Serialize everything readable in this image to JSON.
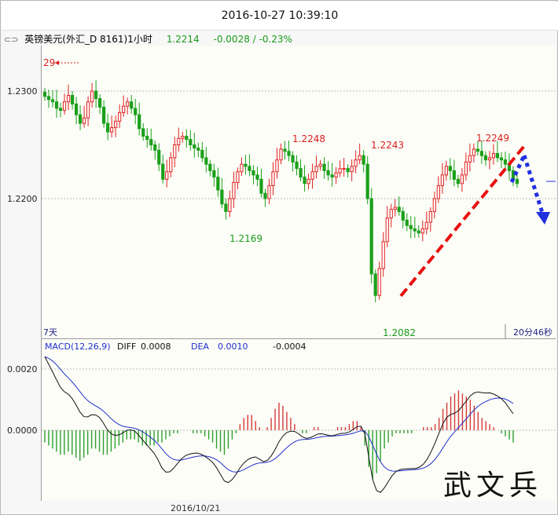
{
  "header": {
    "datetime": "2016-10-27 10:39:10",
    "symbol": "英镑美元(外汇_D 8161)1小时",
    "price": "1.2214",
    "change": "-0.0028 / -0.23%"
  },
  "main_chart": {
    "y_ticks": [
      "1.2300",
      "1.2200"
    ],
    "left_label": "7天",
    "right_label": "20分46秒",
    "marker_29": "29",
    "annotations": [
      {
        "text": "1.2248",
        "color": "red"
      },
      {
        "text": "1.2243",
        "color": "red"
      },
      {
        "text": "1.2249",
        "color": "red"
      },
      {
        "text": "1.2169",
        "color": "green"
      },
      {
        "text": "1.2082",
        "color": "green"
      }
    ]
  },
  "macd": {
    "title": "MACD(12,26,9)",
    "diff_label": "DIFF",
    "diff_value": "0.0008",
    "dea_label": "DEA",
    "dea_value": "0.0010",
    "hist_value": "-0.0004",
    "y_ticks": [
      "0.0020",
      "0.0000"
    ]
  },
  "bottom_date": "2016/10/21",
  "watermark": "武文兵",
  "colors": {
    "up": "#e02020",
    "down": "#1aa01a",
    "diff": "#111111",
    "dea": "#1f2fcc"
  },
  "chart_data": {
    "type": "candlestick",
    "title": "英镑美元(外汇_D 8161)1小时",
    "ylim": [
      1.2055,
      1.2328
    ],
    "y_ticks": [
      1.23,
      1.22
    ],
    "labeled_points": [
      {
        "label": "1.2248",
        "value": 1.2248,
        "kind": "high"
      },
      {
        "label": "1.2243",
        "value": 1.2243,
        "kind": "high"
      },
      {
        "label": "1.2249",
        "value": 1.2249,
        "kind": "high"
      },
      {
        "label": "1.2169",
        "value": 1.2169,
        "kind": "low"
      },
      {
        "label": "1.2082",
        "value": 1.2082,
        "kind": "low"
      }
    ],
    "last_price": 1.2214,
    "closes": [
      1.2295,
      1.2292,
      1.229,
      1.2284,
      1.2282,
      1.229,
      1.2296,
      1.2288,
      1.2278,
      1.227,
      1.2275,
      1.229,
      1.23,
      1.2293,
      1.2285,
      1.227,
      1.2262,
      1.2266,
      1.2272,
      1.228,
      1.2286,
      1.229,
      1.2284,
      1.2278,
      1.2265,
      1.2258,
      1.2255,
      1.225,
      1.2245,
      1.2232,
      1.2218,
      1.2225,
      1.2238,
      1.225,
      1.2256,
      1.2258,
      1.2255,
      1.225,
      1.2247,
      1.2245,
      1.2238,
      1.2232,
      1.2226,
      1.222,
      1.2208,
      1.2195,
      1.2188,
      1.22,
      1.2215,
      1.2225,
      1.2232,
      1.223,
      1.2226,
      1.2222,
      1.2218,
      1.2205,
      1.22,
      1.2212,
      1.2225,
      1.2236,
      1.2246,
      1.2244,
      1.224,
      1.2234,
      1.2228,
      1.222,
      1.2214,
      1.2218,
      1.2225,
      1.223,
      1.2232,
      1.2226,
      1.2222,
      1.222,
      1.2224,
      1.2228,
      1.2228,
      1.2225,
      1.223,
      1.2236,
      1.224,
      1.2232,
      1.22,
      1.213,
      1.211,
      1.2135,
      1.216,
      1.2182,
      1.219,
      1.2192,
      1.2188,
      1.218,
      1.2175,
      1.2172,
      1.217,
      1.2168,
      1.2172,
      1.2178,
      1.2188,
      1.22,
      1.2212,
      1.2222,
      1.223,
      1.2226,
      1.2218,
      1.2214,
      1.2222,
      1.2234,
      1.224,
      1.2246,
      1.2244,
      1.224,
      1.2236,
      1.2238,
      1.2242,
      1.2238,
      1.2236,
      1.2232,
      1.2226,
      1.2218,
      1.2214
    ],
    "macd_hist": [
      -0.0004,
      -0.0005,
      -0.0006,
      -0.0007,
      -0.0008,
      -0.0008,
      -0.0007,
      -0.0008,
      -0.0009,
      -0.001,
      -0.0009,
      -0.0008,
      -0.0006,
      -0.0006,
      -0.0007,
      -0.0008,
      -0.0008,
      -0.0007,
      -0.0006,
      -0.0005,
      -0.0004,
      -0.0003,
      -0.0003,
      -0.0003,
      -0.0004,
      -0.0005,
      -0.0005,
      -0.0005,
      -0.0005,
      -0.0004,
      -0.0004,
      -0.0003,
      -0.0002,
      -0.0001,
      -0.0001,
      0.0,
      0.0,
      0.0,
      -0.0001,
      -0.0001,
      -0.0001,
      -0.0002,
      -0.0003,
      -0.0004,
      -0.0006,
      -0.0007,
      -0.0008,
      -0.0006,
      -0.0003,
      -0.0001,
      0.0002,
      0.0004,
      0.0005,
      0.0005,
      0.0003,
      0.0001,
      0.0,
      0.0001,
      0.0004,
      0.0007,
      0.0009,
      0.0008,
      0.0006,
      0.0004,
      0.0002,
      0.0,
      -0.0001,
      -0.0001,
      0.0,
      0.0001,
      0.0001,
      0.0,
      0.0,
      0.0,
      0.0,
      0.0001,
      0.0001,
      0.0001,
      0.0002,
      0.0003,
      0.0003,
      0.0001,
      -0.0005,
      -0.0012,
      -0.0016,
      -0.0014,
      -0.001,
      -0.0006,
      -0.0004,
      -0.0002,
      -0.0001,
      -0.0001,
      -0.0001,
      -0.0001,
      -0.0001,
      0.0,
      0.0,
      0.0001,
      0.0001,
      0.0001,
      0.0002,
      0.0004,
      0.0007,
      0.0009,
      0.0011,
      0.0012,
      0.0013,
      0.0012,
      0.0011,
      0.001,
      0.0008,
      0.0006,
      0.0004,
      0.0003,
      0.0002,
      0.0001,
      0.0,
      -0.0001,
      -0.0002,
      -0.0003,
      -0.0004
    ]
  }
}
